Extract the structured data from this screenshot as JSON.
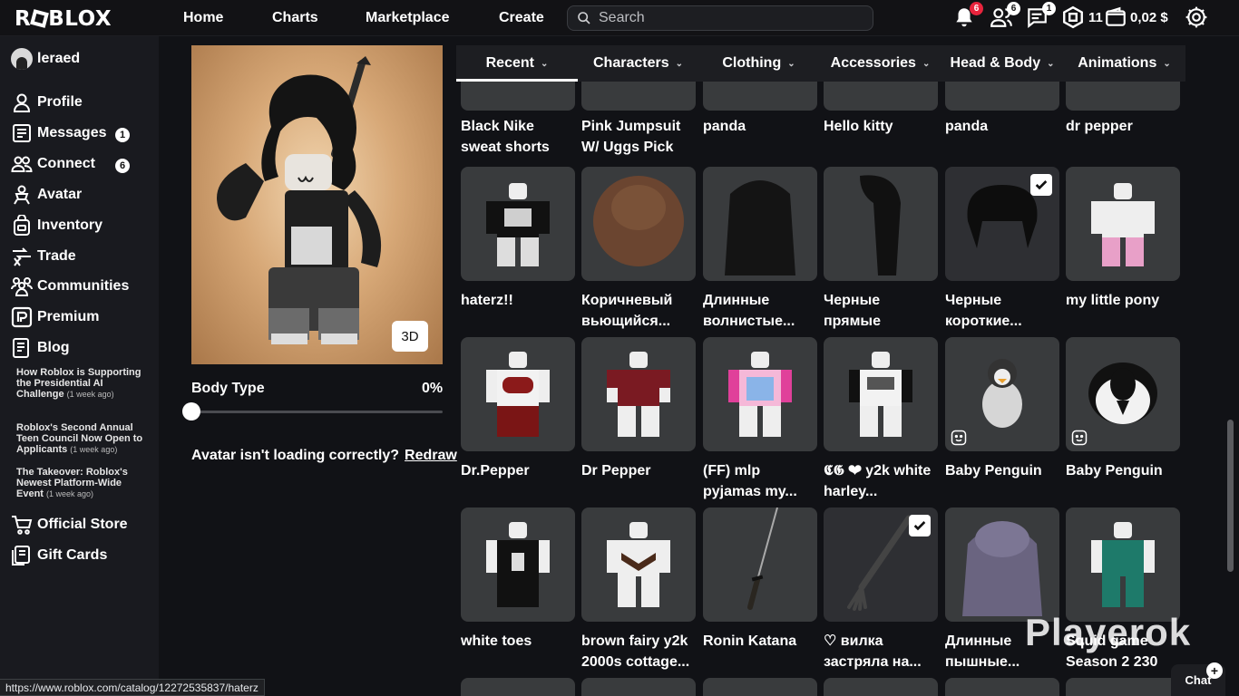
{
  "topbar": {
    "logo": "ROBLOX",
    "nav": [
      "Home",
      "Charts",
      "Marketplace",
      "Create"
    ],
    "search_placeholder": "Search",
    "notifications_count": "6",
    "friends_count": "6",
    "messages_count": "1",
    "robux_amount": "11",
    "currency_amount": "0,02 $"
  },
  "sidebar": {
    "username": "leraed",
    "items": [
      {
        "label": "Profile",
        "icon": "profile-icon"
      },
      {
        "label": "Messages",
        "icon": "messages-icon",
        "badge": "1"
      },
      {
        "label": "Connect",
        "icon": "connect-icon",
        "badge": "6"
      },
      {
        "label": "Avatar",
        "icon": "avatar-icon"
      },
      {
        "label": "Inventory",
        "icon": "inventory-icon"
      },
      {
        "label": "Trade",
        "icon": "trade-icon"
      },
      {
        "label": "Communities",
        "icon": "communities-icon"
      },
      {
        "label": "Premium",
        "icon": "premium-icon"
      },
      {
        "label": "Blog",
        "icon": "blog-icon"
      }
    ],
    "blog_posts": [
      {
        "title": "How Roblox is Supporting the Presidential AI Challenge",
        "age": "(1 week ago)"
      },
      {
        "title": "Roblox's Second Annual Teen Council Now Open to Applicants",
        "age": "(1 week ago)"
      },
      {
        "title": "The Takeover: Roblox's Newest Platform-Wide Event",
        "age": "(1 week ago)"
      }
    ],
    "footer_items": [
      {
        "label": "Official Store",
        "icon": "cart-icon"
      },
      {
        "label": "Gift Cards",
        "icon": "gift-card-icon"
      }
    ]
  },
  "avatar_editor": {
    "view_button": "3D",
    "body_type_label": "Body Type",
    "body_type_value": "0%",
    "body_type_fraction": 0,
    "loading_text": "Avatar isn't loading correctly?",
    "redraw_label": "Redraw"
  },
  "tabs": [
    {
      "label": "Recent",
      "active": true
    },
    {
      "label": "Characters"
    },
    {
      "label": "Clothing"
    },
    {
      "label": "Accessories"
    },
    {
      "label": "Head & Body"
    },
    {
      "label": "Animations"
    }
  ],
  "items_row0": [
    "Black Nike sweat shorts",
    "Pink Jumpsuit W/ Uggs Pick M...",
    "panda",
    "Hello kitty",
    "panda",
    "dr pepper"
  ],
  "items_row1": [
    {
      "name": "haterz!!",
      "kind": "shirt"
    },
    {
      "name": "Коричневый вьющийся...",
      "kind": "hair-brown"
    },
    {
      "name": "Длинные волнистые...",
      "kind": "hair-black-long"
    },
    {
      "name": "Черные прямые волосы",
      "kind": "hair-black-straight"
    },
    {
      "name": "Черные короткие...",
      "kind": "hair-black-short",
      "checked": true
    },
    {
      "name": "my little pony",
      "kind": "pants-pony"
    }
  ],
  "items_row2": [
    {
      "name": "Dr.Pepper",
      "kind": "shirt-drpepper"
    },
    {
      "name": "Dr Pepper",
      "kind": "shirt-drpepper-red"
    },
    {
      "name": "(FF) mlp pyjamas my...",
      "kind": "shirt-mlp"
    },
    {
      "name": "𝕮𝕲 ❤ y2k white harley...",
      "kind": "shirt-harley"
    },
    {
      "name": "Baby Penguin",
      "kind": "penguin",
      "emote": true
    },
    {
      "name": "Baby Penguin",
      "kind": "penguin-head",
      "emote": true
    }
  ],
  "items_row3": [
    {
      "name": "white toes",
      "kind": "outfit-black"
    },
    {
      "name": "brown fairy y2k 2000s cottage...",
      "kind": "outfit-brown"
    },
    {
      "name": "Ronin Katana",
      "kind": "katana"
    },
    {
      "name": "♡ вилка застряла на...",
      "kind": "fork",
      "checked": true
    },
    {
      "name": "Длинные пышные...",
      "kind": "hair-purple"
    },
    {
      "name": "Squid game Season 2 230",
      "kind": "outfit-green"
    }
  ],
  "watermark": "Playerok",
  "chat_label": "Chat",
  "status_url": "https://www.roblox.com/catalog/12272535837/haterz"
}
